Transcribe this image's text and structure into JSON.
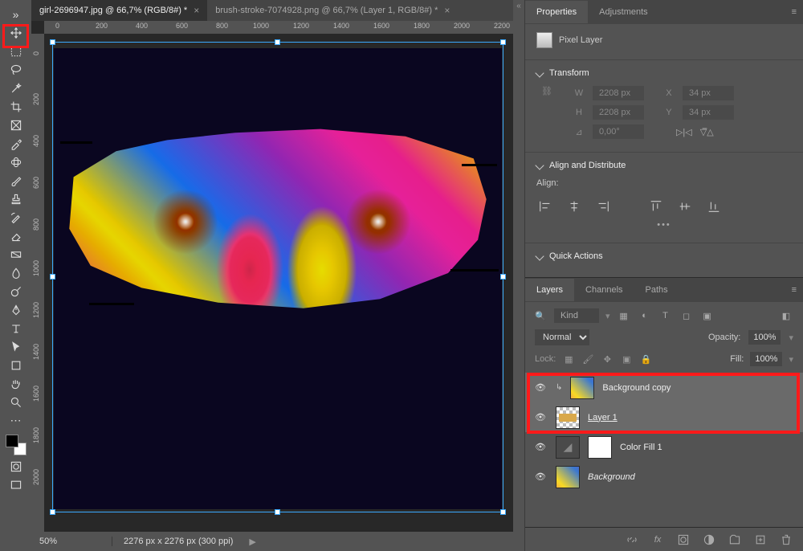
{
  "tabs": [
    {
      "label": "girl-2696947.jpg @ 66,7% (RGB/8#) *",
      "active": true
    },
    {
      "label": "brush-stroke-7074928.png @ 66,7% (Layer 1, RGB/8#) *",
      "active": false
    }
  ],
  "ruler_h": [
    "0",
    "200",
    "400",
    "600",
    "800",
    "1000",
    "1200",
    "1400",
    "1600",
    "1800",
    "2000",
    "2200"
  ],
  "ruler_v": [
    "0",
    "200",
    "400",
    "600",
    "800",
    "1000",
    "1200",
    "1400",
    "1600",
    "1800",
    "2000"
  ],
  "status": {
    "zoom": "50%",
    "dims": "2276 px x 2276 px (300 ppi)"
  },
  "properties": {
    "tabs": [
      "Properties",
      "Adjustments"
    ],
    "layer_type": "Pixel Layer",
    "transform": {
      "title": "Transform",
      "W": "2208 px",
      "H": "2208 px",
      "X": "34 px",
      "Y": "34 px",
      "angle": "0,00°"
    },
    "align": {
      "title": "Align and Distribute",
      "label": "Align:"
    },
    "quick": {
      "title": "Quick Actions"
    }
  },
  "layers_panel": {
    "tabs": [
      "Layers",
      "Channels",
      "Paths"
    ],
    "kind_label": "Kind",
    "blend": "Normal",
    "opacity_label": "Opacity:",
    "opacity": "100%",
    "lock_label": "Lock:",
    "fill_label": "Fill:",
    "fill": "100%",
    "layers": [
      {
        "name": "Background copy",
        "clip": true,
        "thumb": "image"
      },
      {
        "name": "Layer 1",
        "underline": true,
        "thumb": "checker"
      },
      {
        "name": "Color Fill 1",
        "mask": true,
        "thumb": "white"
      },
      {
        "name": "Background",
        "italic": true,
        "thumb": "image"
      }
    ]
  }
}
